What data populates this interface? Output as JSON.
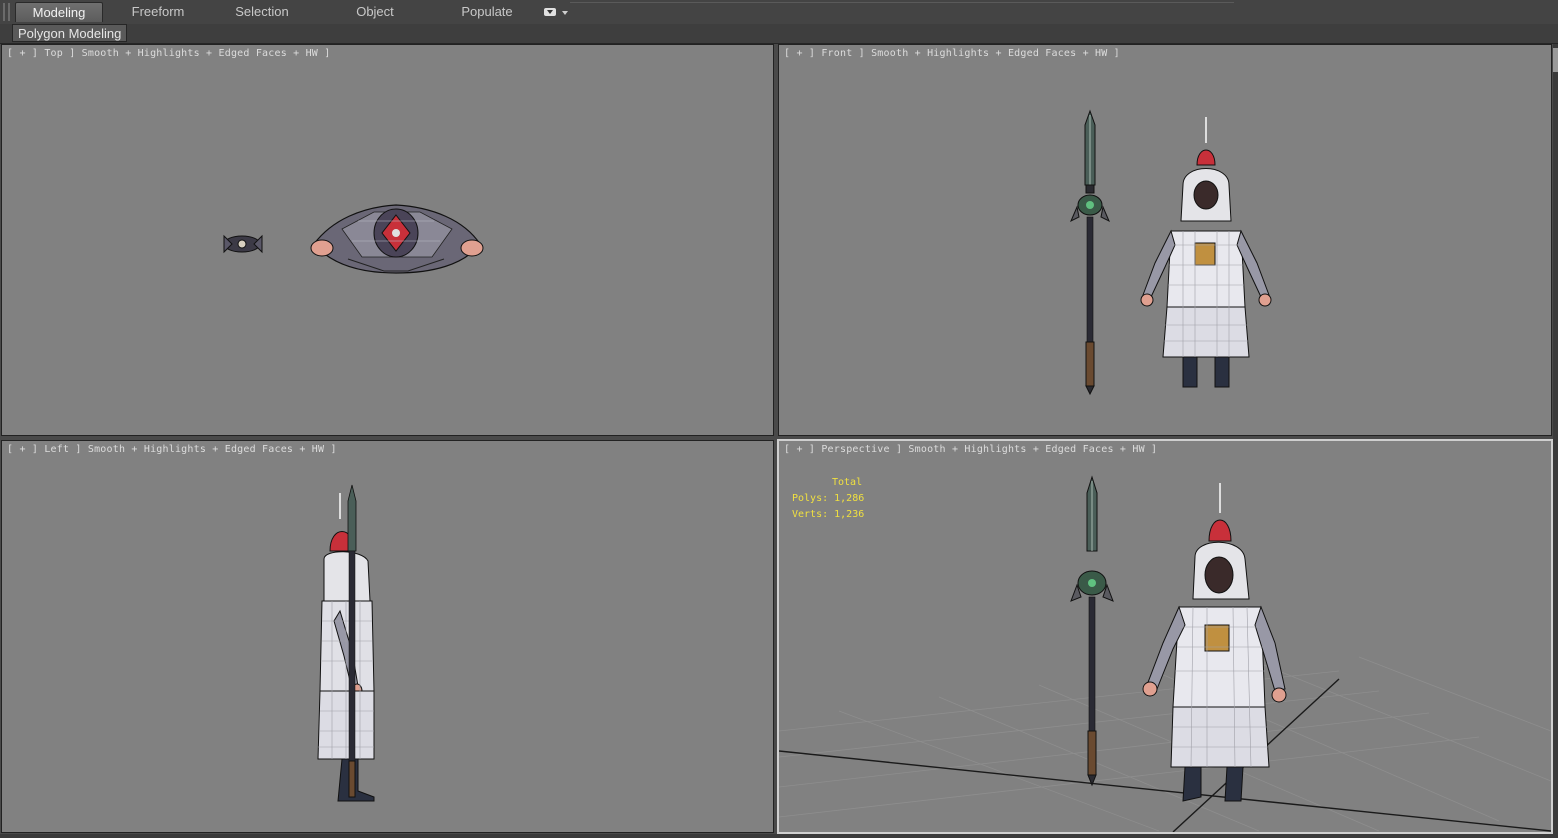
{
  "ribbon": {
    "tabs": [
      {
        "label": "Modeling",
        "active": true
      },
      {
        "label": "Freeform",
        "active": false
      },
      {
        "label": "Selection",
        "active": false
      },
      {
        "label": "Object Paint",
        "active": false
      },
      {
        "label": "Populate",
        "active": false
      }
    ],
    "overflow_icon": "dropdown-icon"
  },
  "subribbon": {
    "panel_label": "Polygon Modeling"
  },
  "viewports": {
    "top": {
      "label": "[ + ] Top ] Smooth + Highlights + Edged Faces + HW ]"
    },
    "front": {
      "label": "[ + ] Front ] Smooth + Highlights + Edged Faces + HW ]"
    },
    "left": {
      "label": "[ + ] Left ] Smooth + Highlights + Edged Faces + HW ]"
    },
    "perspective": {
      "label": "[ + ] Perspective ] Smooth + Highlights + Edged Faces + HW ]",
      "stats": {
        "total_label": "Total",
        "polys": "Polys: 1,286",
        "verts": "Verts: 1,236"
      }
    }
  },
  "colors": {
    "viewport_bg": "#818181",
    "ui_bg": "#444444",
    "helmet_red": "#c8303a",
    "stats_yellow": "#f0e040"
  }
}
